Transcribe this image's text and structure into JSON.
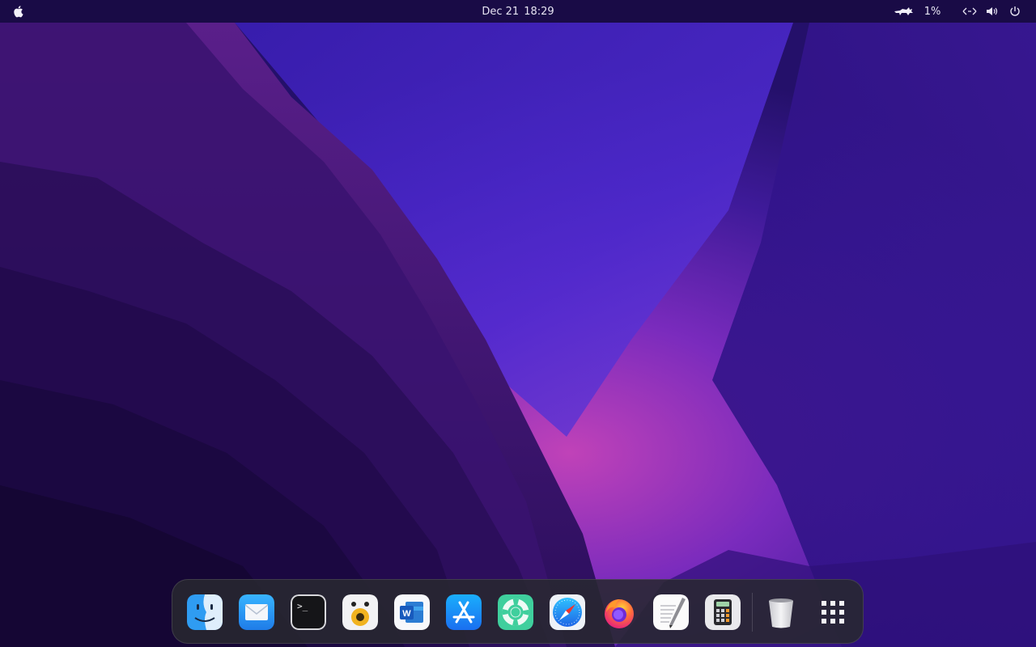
{
  "topbar": {
    "apple_icon": "apple-logo-icon",
    "date": "Dec 21",
    "time": "18:29",
    "weather_icon": "cat-weather-icon",
    "battery_percent": "1%",
    "tray_icons": [
      "network-icon",
      "volume-icon",
      "power-icon"
    ]
  },
  "dock": {
    "apps": [
      {
        "name": "Finder",
        "icon": "finder-icon"
      },
      {
        "name": "Mail",
        "icon": "mail-icon"
      },
      {
        "name": "Terminal",
        "icon": "terminal-icon",
        "glyph": ">_"
      },
      {
        "name": "Music Player",
        "icon": "speaker-icon"
      },
      {
        "name": "Word",
        "icon": "word-icon",
        "glyph": "W"
      },
      {
        "name": "App Store",
        "icon": "app-store-icon"
      },
      {
        "name": "Help",
        "icon": "lifebuoy-icon"
      },
      {
        "name": "Safari",
        "icon": "safari-compass-icon"
      },
      {
        "name": "Firefox",
        "icon": "firefox-icon"
      },
      {
        "name": "TextEdit",
        "icon": "text-editor-icon"
      },
      {
        "name": "Calculator",
        "icon": "calculator-icon"
      }
    ],
    "trash_icon": "trash-icon",
    "app_grid_icon": "app-grid-icon"
  },
  "colors": {
    "wallpaper_dark": "#1d0b4f",
    "wallpaper_purple": "#5a1fa8",
    "wallpaper_magenta": "#a02bb0",
    "topbar_bg": "#160a3c",
    "dock_bg": "#28282f"
  }
}
